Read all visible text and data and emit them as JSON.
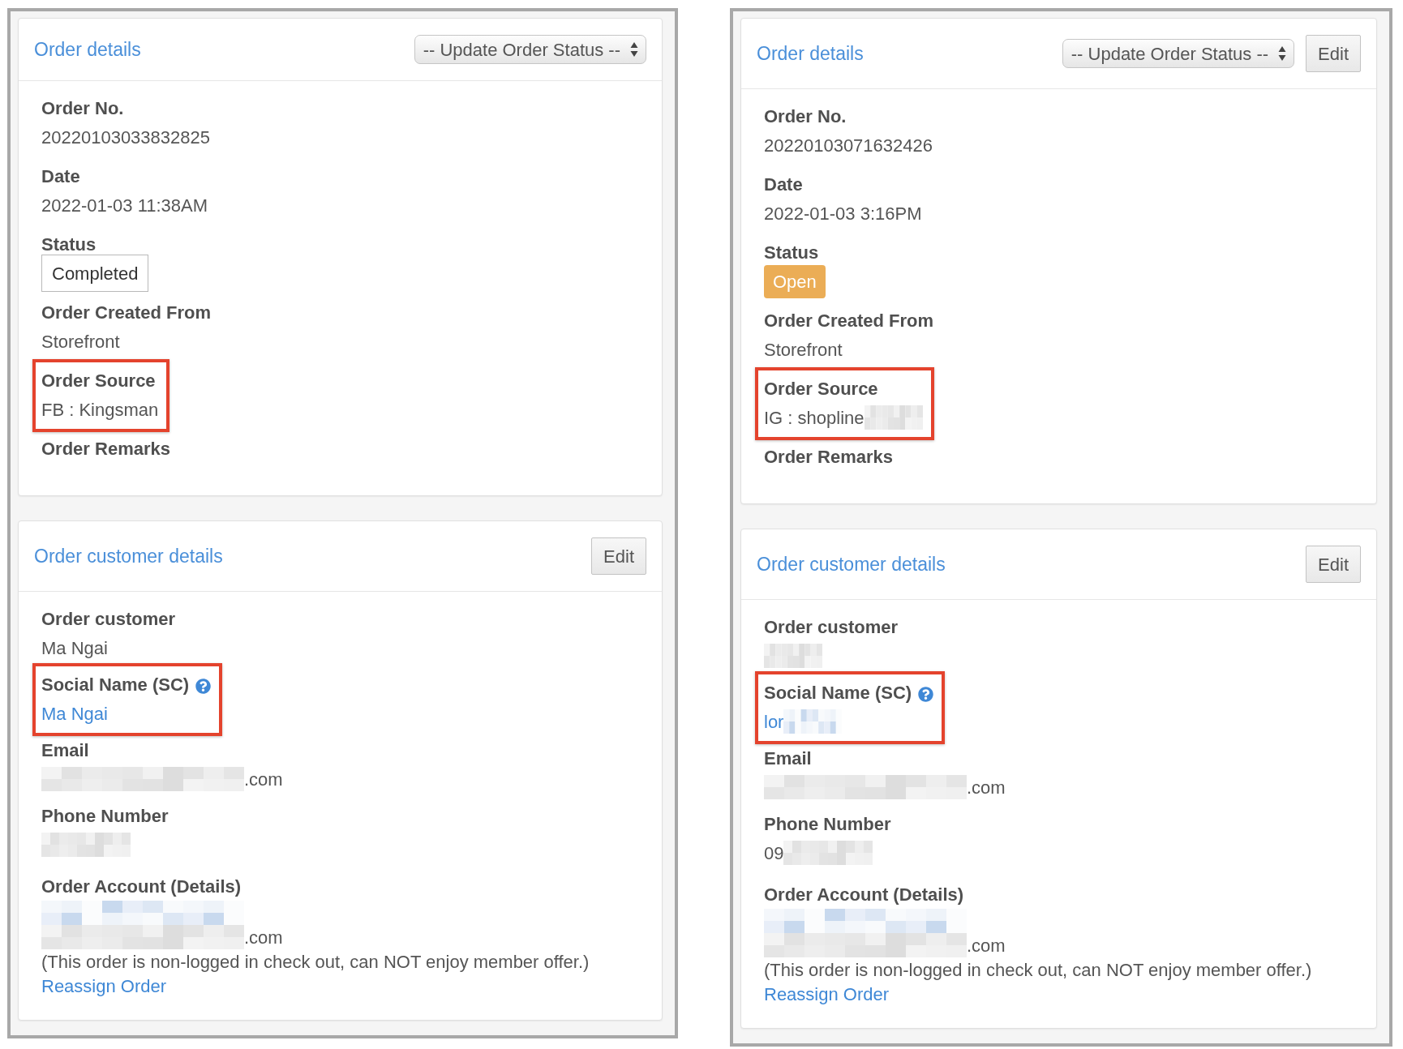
{
  "panels": [
    {
      "cards": [
        {
          "title": "Order details",
          "status_select": {
            "value": "-- Update Order Status --"
          },
          "fields": [
            {
              "kind": "plain",
              "label": "Order No.",
              "highlighted": false,
              "lines": [
                [
                  {
                    "kind": "text",
                    "text": "20220103033832825"
                  }
                ]
              ]
            },
            {
              "kind": "plain",
              "label": "Date",
              "highlighted": false,
              "lines": [
                [
                  {
                    "kind": "text",
                    "text": "2022-01-03 11:38AM"
                  }
                ]
              ]
            },
            {
              "kind": "status",
              "label": "Status",
              "highlighted": false,
              "lines": [
                [
                  {
                    "kind": "box",
                    "text": "Completed"
                  }
                ]
              ]
            },
            {
              "kind": "plain",
              "label": "Order Created From",
              "highlighted": false,
              "lines": [
                [
                  {
                    "kind": "text",
                    "text": "Storefront"
                  }
                ]
              ]
            },
            {
              "kind": "plain",
              "label": "Order Source",
              "highlighted": true,
              "lines": [
                [
                  {
                    "kind": "text",
                    "text": "FB : Kingsman"
                  }
                ]
              ]
            },
            {
              "kind": "plain",
              "label": "Order Remarks",
              "highlighted": false
            }
          ]
        },
        {
          "title": "Order customer details",
          "buttons": [
            "Edit"
          ],
          "fields": [
            {
              "kind": "plain",
              "label": "Order customer",
              "highlighted": false,
              "lines": [
                [
                  {
                    "kind": "text",
                    "text": "Ma Ngai"
                  }
                ]
              ]
            },
            {
              "kind": "social",
              "label": "Social Name (SC)",
              "highlighted": true,
              "lines": [
                [
                  {
                    "kind": "link",
                    "text": "Ma Ngai"
                  }
                ]
              ]
            },
            {
              "kind": "email",
              "label": "Email",
              "highlighted": false,
              "lines": [
                [
                  {
                    "kind": "redacted"
                  },
                  {
                    "kind": "text",
                    "text": ".com"
                  }
                ]
              ]
            },
            {
              "kind": "phone",
              "label": "Phone Number",
              "highlighted": false,
              "lines": [
                [
                  {
                    "kind": "redacted"
                  }
                ]
              ]
            },
            {
              "kind": "account",
              "label": "Order Account (Details)",
              "highlighted": false,
              "lines": [
                [
                  {
                    "kind": "redactedlink"
                  }
                ],
                [
                  {
                    "kind": "redacted"
                  },
                  {
                    "kind": "text",
                    "text": ".com"
                  }
                ],
                [
                  {
                    "kind": "text",
                    "text": "(This order is non-logged in check out, can NOT enjoy member offer.)"
                  }
                ],
                [
                  {
                    "kind": "link",
                    "text": "Reassign Order"
                  }
                ]
              ]
            }
          ]
        }
      ]
    },
    {
      "cards": [
        {
          "title": "Order details",
          "status_select": {
            "value": "-- Update Order Status --"
          },
          "buttons": [
            "Edit"
          ],
          "fields": [
            {
              "kind": "plain",
              "label": "Order No.",
              "highlighted": false,
              "lines": [
                [
                  {
                    "kind": "text",
                    "text": "20220103071632426"
                  }
                ]
              ]
            },
            {
              "kind": "plain",
              "label": "Date",
              "highlighted": false,
              "lines": [
                [
                  {
                    "kind": "text",
                    "text": "2022-01-03 3:16PM"
                  }
                ]
              ]
            },
            {
              "kind": "status",
              "label": "Status",
              "highlighted": false,
              "lines": [
                [
                  {
                    "kind": "badge",
                    "text": "Open"
                  }
                ]
              ]
            },
            {
              "kind": "plain",
              "label": "Order Created From",
              "highlighted": false,
              "lines": [
                [
                  {
                    "kind": "text",
                    "text": "Storefront"
                  }
                ]
              ]
            },
            {
              "kind": "plain",
              "label": "Order Source",
              "highlighted": true,
              "lines": [
                [
                  {
                    "kind": "text",
                    "text": "IG : shopline"
                  },
                  {
                    "kind": "redacted"
                  }
                ]
              ]
            },
            {
              "kind": "plain",
              "label": "Order Remarks",
              "highlighted": false
            }
          ]
        },
        {
          "title": "Order customer details",
          "buttons": [
            "Edit"
          ],
          "fields": [
            {
              "kind": "plain",
              "label": "Order customer",
              "highlighted": false,
              "lines": [
                [
                  {
                    "kind": "redacted"
                  }
                ]
              ]
            },
            {
              "kind": "social",
              "label": "Social Name (SC)",
              "highlighted": true,
              "lines": [
                [
                  {
                    "kind": "link",
                    "text": "lor"
                  },
                  {
                    "kind": "redactedlink"
                  }
                ]
              ]
            },
            {
              "kind": "email",
              "label": "Email",
              "highlighted": false,
              "lines": [
                [
                  {
                    "kind": "redacted"
                  },
                  {
                    "kind": "text",
                    "text": ".com"
                  }
                ]
              ]
            },
            {
              "kind": "phone",
              "label": "Phone Number",
              "highlighted": false,
              "lines": [
                [
                  {
                    "kind": "text",
                    "text": "09"
                  },
                  {
                    "kind": "redacted"
                  }
                ]
              ]
            },
            {
              "kind": "account",
              "label": "Order Account (Details)",
              "highlighted": false,
              "lines": [
                [
                  {
                    "kind": "redactedlink"
                  }
                ],
                [
                  {
                    "kind": "redacted"
                  },
                  {
                    "kind": "text",
                    "text": ".com"
                  }
                ],
                [
                  {
                    "kind": "text",
                    "text": "(This order is non-logged in check out, can NOT enjoy member offer.)"
                  }
                ],
                [
                  {
                    "kind": "link",
                    "text": "Reassign Order"
                  }
                ]
              ]
            }
          ]
        }
      ]
    }
  ]
}
